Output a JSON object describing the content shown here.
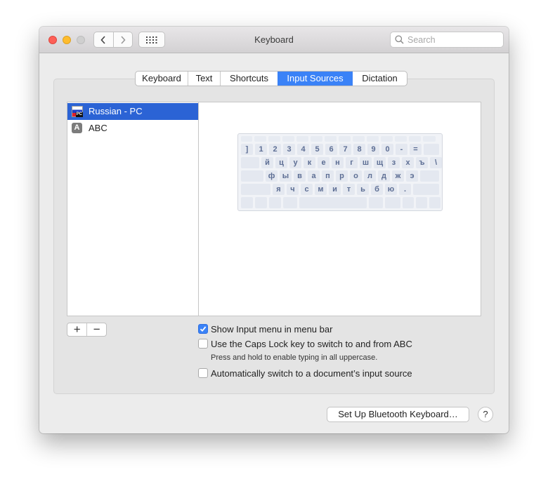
{
  "window": {
    "title": "Keyboard",
    "search_placeholder": "Search"
  },
  "tabs": [
    {
      "label": "Keyboard"
    },
    {
      "label": "Text"
    },
    {
      "label": "Shortcuts"
    },
    {
      "label": "Input Sources",
      "selected": true
    },
    {
      "label": "Dictation"
    }
  ],
  "sources": [
    {
      "label": "Russian - PC",
      "icon": "russian-flag-icon",
      "selected": true
    },
    {
      "label": "ABC",
      "icon": "abc-letter-icon",
      "icon_text": "A",
      "selected": false
    }
  ],
  "keyboard_preview": {
    "rows": [
      [
        "]",
        "1",
        "2",
        "3",
        "4",
        "5",
        "6",
        "7",
        "8",
        "9",
        "0",
        "-",
        "="
      ],
      [
        "й",
        "ц",
        "у",
        "к",
        "е",
        "н",
        "г",
        "ш",
        "щ",
        "з",
        "х",
        "ъ",
        "\\"
      ],
      [
        "ф",
        "ы",
        "в",
        "а",
        "п",
        "р",
        "о",
        "л",
        "д",
        "ж",
        "э"
      ],
      [
        "я",
        "ч",
        "с",
        "м",
        "и",
        "т",
        "ь",
        "б",
        "ю",
        "."
      ]
    ]
  },
  "list_controls": {
    "add_label": "+",
    "remove_label": "−"
  },
  "options": {
    "show_input_menu": {
      "label": "Show Input menu in menu bar",
      "checked": true
    },
    "caps_lock_switch": {
      "label": "Use the Caps Lock key to switch to and from ABC",
      "checked": false
    },
    "caps_lock_hint": "Press and hold to enable typing in all uppercase.",
    "auto_switch": {
      "label": "Automatically switch to a document’s input source",
      "checked": false
    }
  },
  "buttons": {
    "bluetooth": "Set Up Bluetooth Keyboard…",
    "help": "?"
  },
  "colors": {
    "accent": "#3a82f7",
    "selection": "#2b63d5"
  }
}
